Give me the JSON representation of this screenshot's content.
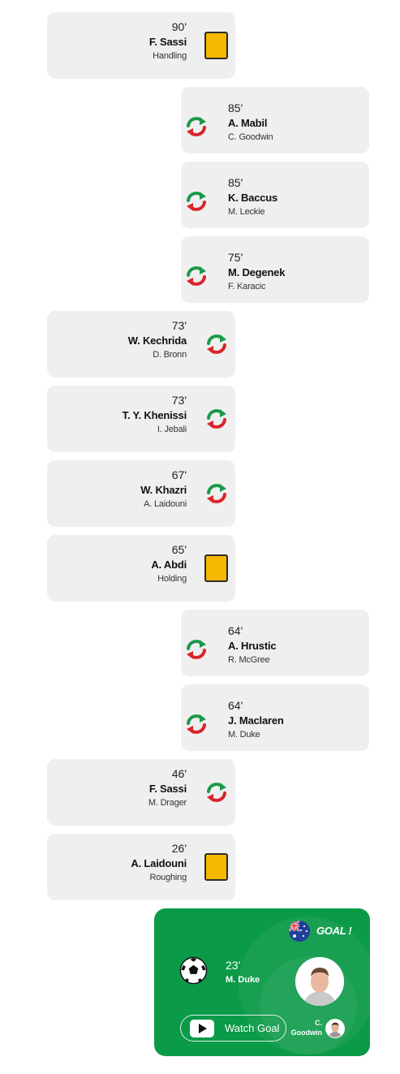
{
  "events": [
    {
      "minute": "90'",
      "player": "F. Sassi",
      "detail": "Handling",
      "type": "yellow-card",
      "side": "left"
    },
    {
      "minute": "85'",
      "player": "A. Mabil",
      "detail": "C. Goodwin",
      "type": "substitution",
      "side": "right"
    },
    {
      "minute": "85'",
      "player": "K. Baccus",
      "detail": "M. Leckie",
      "type": "substitution",
      "side": "right"
    },
    {
      "minute": "75'",
      "player": "M. Degenek",
      "detail": "F. Karacic",
      "type": "substitution",
      "side": "right"
    },
    {
      "minute": "73'",
      "player": "W. Kechrida",
      "detail": "D. Bronn",
      "type": "substitution",
      "side": "left"
    },
    {
      "minute": "73'",
      "player": "T. Y. Khenissi",
      "detail": "I. Jebali",
      "type": "substitution",
      "side": "left"
    },
    {
      "minute": "67'",
      "player": "W. Khazri",
      "detail": "A. Laidouni",
      "type": "substitution",
      "side": "left"
    },
    {
      "minute": "65'",
      "player": "A. Abdi",
      "detail": "Holding",
      "type": "yellow-card",
      "side": "left"
    },
    {
      "minute": "64'",
      "player": "A. Hrustic",
      "detail": "R. McGree",
      "type": "substitution",
      "side": "right"
    },
    {
      "minute": "64'",
      "player": "J. Maclaren",
      "detail": "M. Duke",
      "type": "substitution",
      "side": "right"
    },
    {
      "minute": "46'",
      "player": "F. Sassi",
      "detail": "M. Drager",
      "type": "substitution",
      "side": "left"
    },
    {
      "minute": "26'",
      "player": "A. Laidouni",
      "detail": "Roughing",
      "type": "yellow-card",
      "side": "left"
    }
  ],
  "goal": {
    "label": "GOAL !",
    "minute": "23'",
    "scorer": "M. Duke",
    "watch_label": "Watch Goal",
    "assist": "C. Goodwin",
    "flag_icon": "australia-flag-icon",
    "background": "#0b9a48"
  },
  "colors": {
    "card_bg": "#efefef",
    "yellow_card": "#f6b800",
    "sub_green": "#1a9a4a",
    "sub_red": "#d8252b"
  }
}
